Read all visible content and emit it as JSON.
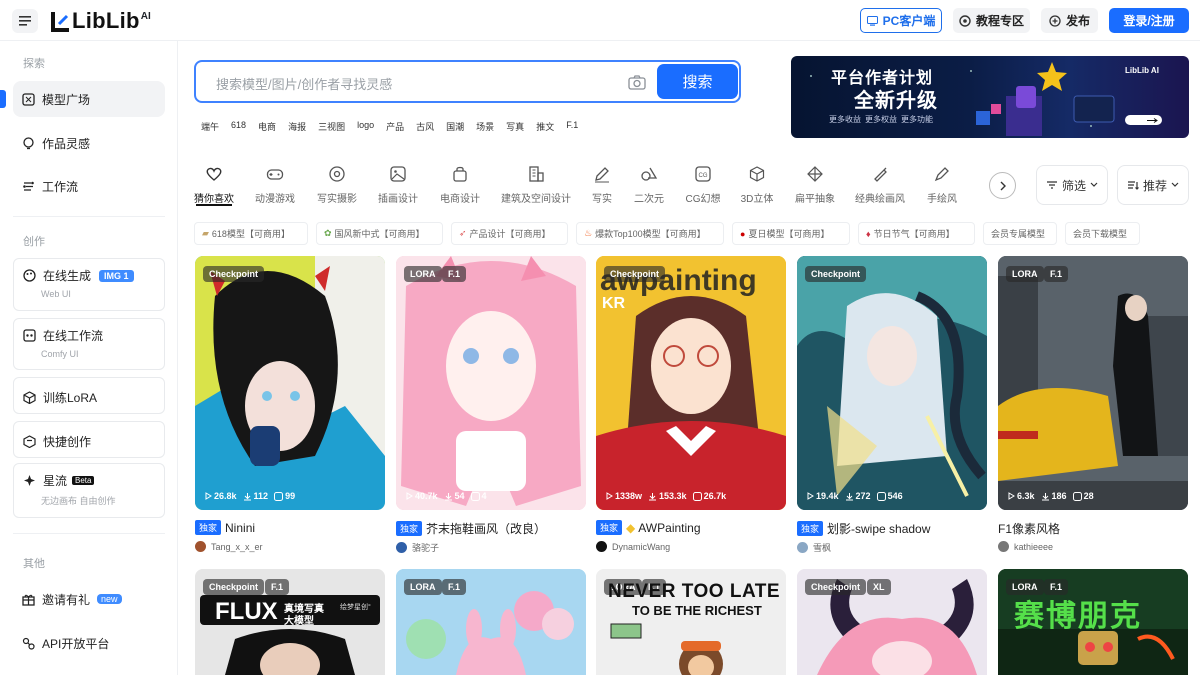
{
  "header": {
    "logo_text": "LibLib",
    "logo_sup": "AI",
    "pc_client": "PC客户端",
    "tutorial": "教程专区",
    "publish": "发布",
    "login": "登录/注册"
  },
  "sidebar": {
    "explore_title": "探索",
    "create_title": "创作",
    "other_title": "其他",
    "items": {
      "model_square": "模型广场",
      "inspiration": "作品灵感",
      "workflow": "工作流",
      "online_gen": "在线生成",
      "online_gen_badge": "IMG 1",
      "online_gen_sub": "Web UI",
      "online_workflow": "在线工作流",
      "online_workflow_sub": "Comfy UI",
      "train_lora": "训练LoRA",
      "quick_create": "快捷创作",
      "xingliu": "星流",
      "xingliu_badge": "Beta",
      "xingliu_sub": "无边画布 自由创作",
      "invite": "邀请有礼",
      "invite_badge": "new",
      "api": "API开放平台"
    }
  },
  "search": {
    "placeholder": "搜索模型/图片/创作者寻找灵感",
    "button": "搜索",
    "hot_tags": [
      "端午",
      "618",
      "电商",
      "海报",
      "三视图",
      "logo",
      "产品",
      "古风",
      "国潮",
      "场景",
      "写真",
      "推文",
      "F.1"
    ]
  },
  "banner": {
    "line1": "平台作者计划",
    "line2": "全新升级",
    "subs": [
      "更多收益",
      "更多权益",
      "更多功能"
    ],
    "logo": "LibLib AI"
  },
  "categories": [
    "猜你喜欢",
    "动漫游戏",
    "写实摄影",
    "插画设计",
    "电商设计",
    "建筑及空间设计",
    "写实",
    "二次元",
    "CG幻想",
    "3D立体",
    "扁平抽象",
    "经典绘画风",
    "手绘风"
  ],
  "filters": {
    "filter": "筛选",
    "sort": "推荐"
  },
  "sub_tags": [
    "618模型【可商用】",
    "国风新中式【可商用】",
    "产品设计【可商用】",
    "爆款Top100模型【可商用】",
    "夏日模型【可商用】",
    "节日节气【可商用】",
    "会员专属模型",
    "会员下载模型"
  ],
  "cards": [
    {
      "type": "Checkpoint",
      "runs": "26.8k",
      "downloads": "112",
      "likes": "99",
      "exclusive": true,
      "title": "Ninini",
      "author": "Tang_x_x_er",
      "colors": {
        "bg": "#3fb9e3",
        "accent": "#161616"
      }
    },
    {
      "type": "LORA",
      "base": "F.1",
      "runs": "40.7k",
      "downloads": "54",
      "likes": "4",
      "exclusive": true,
      "title": "芥末拖鞋画风（改良）",
      "author": "骆驼子",
      "colors": {
        "bg": "#f7c6d6",
        "accent": "#f59ab8"
      }
    },
    {
      "type": "Checkpoint",
      "runs": "1338w",
      "downloads": "153.3k",
      "likes": "26.7k",
      "exclusive": true,
      "title": "AWPainting",
      "author": "DynamicWang",
      "colors": {
        "bg": "#f2c230",
        "accent": "#c8232c"
      }
    },
    {
      "type": "Checkpoint",
      "runs": "19.4k",
      "downloads": "272",
      "likes": "546",
      "exclusive": true,
      "title": "划影-swipe shadow",
      "author": "雪枫",
      "colors": {
        "bg": "#2d6f7e",
        "accent": "#d8e6f0"
      }
    },
    {
      "type": "LORA",
      "base": "F.1",
      "runs": "6.3k",
      "downloads": "186",
      "likes": "28",
      "exclusive": false,
      "title": "F1像素风格",
      "author": "kathieeee",
      "colors": {
        "bg": "#4b5258",
        "accent": "#e4b51c"
      }
    }
  ],
  "bottom_cards": [
    {
      "type": "Checkpoint",
      "base": "F.1",
      "text1": "FLUX",
      "text2": "真境写真",
      "text3": "大模型",
      "brand": "绘梦星创°",
      "colors": {
        "bg": "#e9e9e9"
      }
    },
    {
      "type": "LORA",
      "base": "F.1",
      "colors": {
        "bg": "#9fd3f0"
      }
    },
    {
      "type": "LORA",
      "base": "F.1",
      "text1": "NEVER TOO LATE",
      "text2": "TO BE THE RICHEST",
      "colors": {
        "bg": "#ededed"
      }
    },
    {
      "type": "Checkpoint",
      "base": "XL",
      "colors": {
        "bg": "#ebe6ef"
      }
    },
    {
      "type": "LORA",
      "base": "F.1",
      "text1": "赛博朋克",
      "colors": {
        "bg": "#163a1e"
      }
    }
  ],
  "theme": {
    "accent": "#1a6dff",
    "exclusive_badge": "#1a6dff"
  }
}
